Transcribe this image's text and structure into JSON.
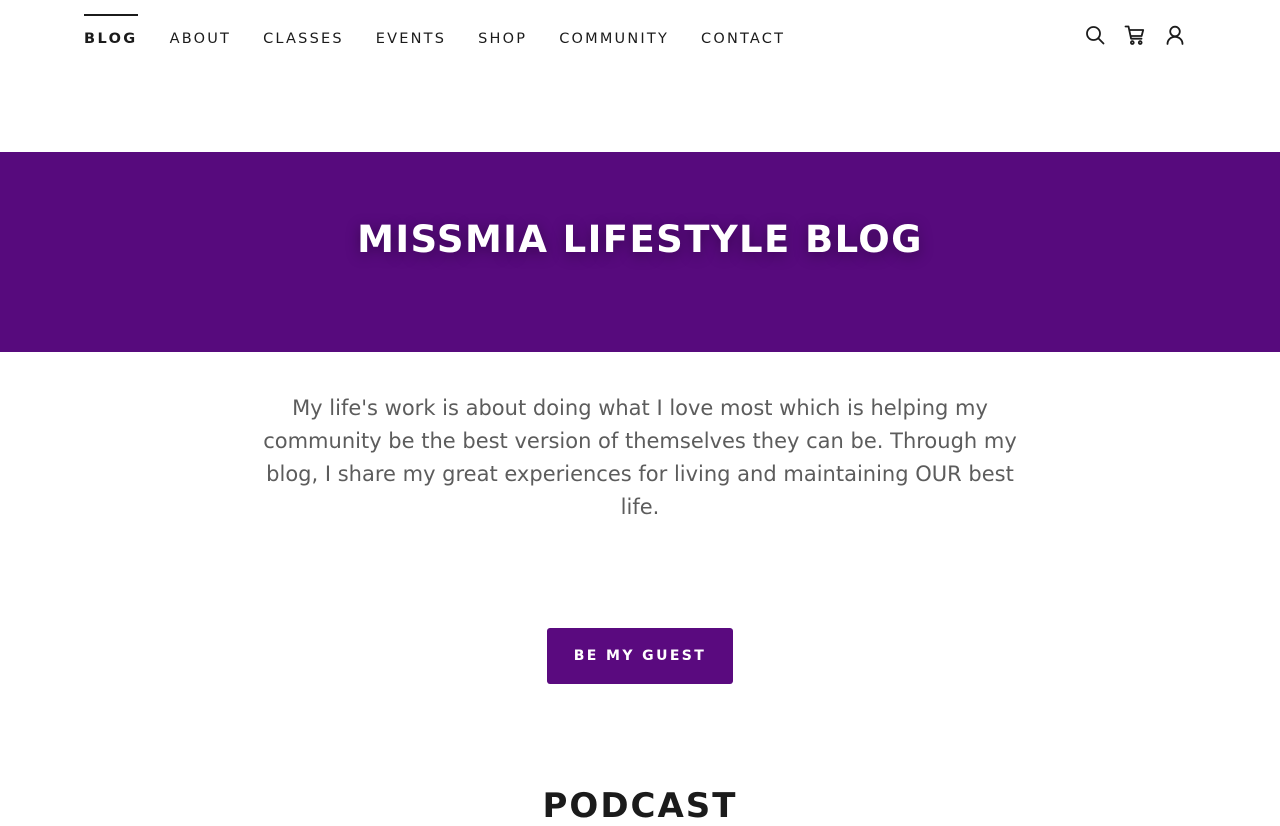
{
  "nav": {
    "items": [
      {
        "label": "BLOG",
        "active": true
      },
      {
        "label": "ABOUT",
        "active": false
      },
      {
        "label": "CLASSES",
        "active": false
      },
      {
        "label": "EVENTS",
        "active": false
      },
      {
        "label": "SHOP",
        "active": false
      },
      {
        "label": "COMMUNITY",
        "active": false
      },
      {
        "label": "CONTACT",
        "active": false
      }
    ],
    "icons": [
      "search-icon",
      "cart-icon",
      "account-icon"
    ]
  },
  "hero": {
    "title": "MISSMIA LIFESTYLE BLOG",
    "background_color": "#570a7d"
  },
  "intro": {
    "text": "My life's work is about doing what I love most which is helping my community be the best version of themselves they can be. Through my blog, I share my great experiences for living and maintaining OUR best life."
  },
  "cta": {
    "label": "BE MY GUEST",
    "color": "#5a0a7f"
  },
  "next_section": {
    "heading": "PODCAST"
  }
}
